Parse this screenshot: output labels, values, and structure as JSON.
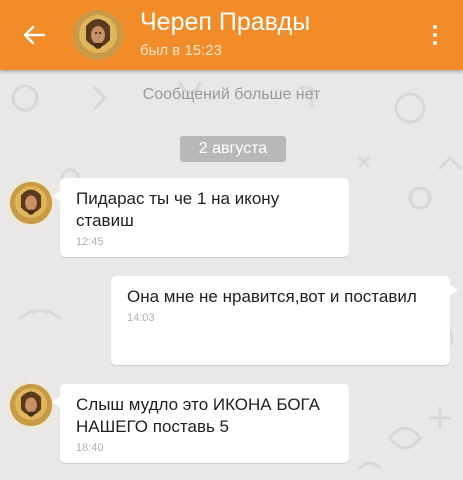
{
  "header": {
    "title": "Череп Правды",
    "status": "был в 15:23",
    "back_icon": "arrow-left-icon",
    "menu_icon": "more-vertical-icon",
    "accent_color": "#f28c28"
  },
  "chat": {
    "no_more_messages": "Сообщений больше нет",
    "date_separator": "2 августа",
    "messages": [
      {
        "from": "contact",
        "text": "Пидарас ты че 1 на икону ставиш",
        "time": "12:45"
      },
      {
        "from": "me",
        "text": "Она мне не нравится,вот и поставил",
        "time": "14:03"
      },
      {
        "from": "contact",
        "text": "Слыш мудло это ИКОНА БОГА НАШЕГО поставь 5",
        "time": "18:40"
      }
    ]
  }
}
